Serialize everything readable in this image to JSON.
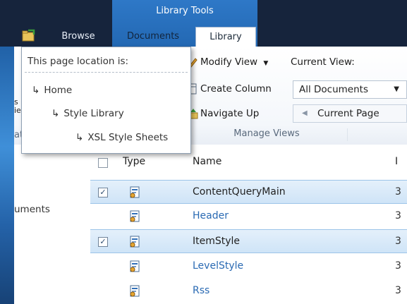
{
  "ribbon": {
    "contextual_group": "Library Tools",
    "tabs": [
      {
        "label": "Browse"
      },
      {
        "label": "Documents"
      },
      {
        "label": "Library"
      }
    ],
    "buttons": {
      "modify_view": "Modify View",
      "create_column": "Create Column",
      "navigate_up": "Navigate Up",
      "current_view_label": "Current View:",
      "current_view_value": "All Documents",
      "current_page": "Current Page"
    },
    "group_label": "Manage Views",
    "left_fragments": [
      "s",
      "ie",
      "at"
    ]
  },
  "location_popup": {
    "title": "This page location is:",
    "crumbs": [
      "Home",
      "Style Library",
      "XSL Style Sheets"
    ]
  },
  "left_nav": {
    "item": "uments"
  },
  "list": {
    "columns": {
      "type": "Type",
      "name": "Name"
    },
    "rows": [
      {
        "name": "ContentQueryMain",
        "selected": true,
        "link": false
      },
      {
        "name": "Header",
        "selected": false,
        "link": true
      },
      {
        "name": "ItemStyle",
        "selected": true,
        "link": false
      },
      {
        "name": "LevelStyle",
        "selected": false,
        "link": true
      },
      {
        "name": "Rss",
        "selected": false,
        "link": true
      }
    ]
  },
  "colors": {
    "accent": "#2e78c7",
    "selected_row": "#cfe4f7",
    "link": "#2a6ab3"
  }
}
